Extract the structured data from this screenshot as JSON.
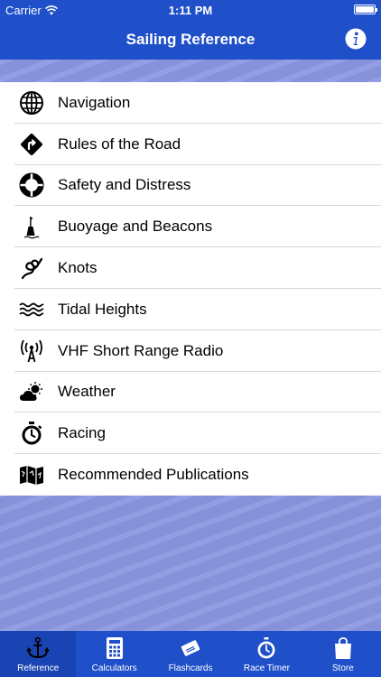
{
  "status_bar": {
    "carrier": "Carrier",
    "time": "1:11 PM"
  },
  "nav": {
    "title": "Sailing Reference",
    "info_icon": "info-icon"
  },
  "menu": {
    "items": [
      {
        "label": "Navigation",
        "icon": "globe-icon"
      },
      {
        "label": "Rules of the Road",
        "icon": "road-sign-icon"
      },
      {
        "label": "Safety and Distress",
        "icon": "lifebuoy-icon"
      },
      {
        "label": "Buoyage and Beacons",
        "icon": "buoy-icon"
      },
      {
        "label": "Knots",
        "icon": "knot-icon"
      },
      {
        "label": "Tidal Heights",
        "icon": "waves-icon"
      },
      {
        "label": "VHF Short Range Radio",
        "icon": "radio-antenna-icon"
      },
      {
        "label": "Weather",
        "icon": "weather-icon"
      },
      {
        "label": "Racing",
        "icon": "stopwatch-icon"
      },
      {
        "label": "Recommended Publications",
        "icon": "map-icon"
      }
    ]
  },
  "tabs": [
    {
      "label": "Reference",
      "icon": "anchor-icon",
      "active": true
    },
    {
      "label": "Calculators",
      "icon": "calculator-icon"
    },
    {
      "label": "Flashcards",
      "icon": "flashcards-icon"
    },
    {
      "label": "Race Timer",
      "icon": "stopwatch-icon"
    },
    {
      "label": "Store",
      "icon": "shopping-bag-icon"
    }
  ],
  "colors": {
    "bar": "#1f4fc9",
    "active_tab": "#1a44b3",
    "background": "#8b97e0"
  }
}
